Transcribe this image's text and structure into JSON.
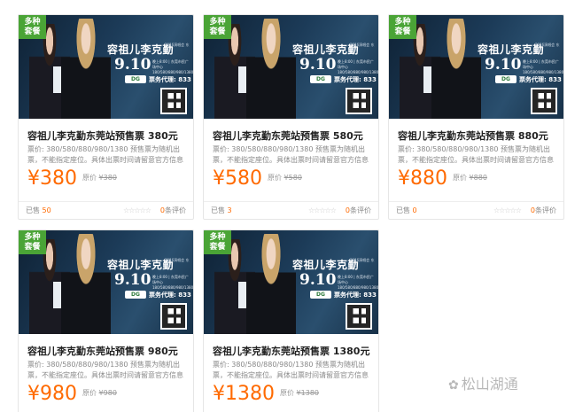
{
  "banner": {
    "tag": "多种\n套餐",
    "title": "容祖儿李克勤",
    "subtitle": "2016演唱会 东莞站",
    "date": "9.10",
    "venue": "晚上8:00 | 东莞市民广场中心 180/580/880/980/1380",
    "logo": "DG",
    "hotline": "票务代理: 833 12345"
  },
  "products": [
    {
      "name": "容祖儿李克勤东莞站预售票 380元",
      "desc": "票价: 380/580/880/980/1380 预售票为随机出票，不能指定座位。具体出票时间请留意官方信息(若：购买",
      "price": "¥380",
      "orig_label": "原价",
      "orig": "¥380",
      "sold_label": "已售",
      "sold": "50",
      "rating": "☆☆☆☆☆",
      "reviews": "0",
      "reviews_label": "条评价"
    },
    {
      "name": "容祖儿李克勤东莞站预售票 580元",
      "desc": "票价: 380/580/880/980/1380 预售票为随机出票，不能指定座位。具体出票时间请留意官方信息(若：购买",
      "price": "¥580",
      "orig_label": "原价",
      "orig": "¥580",
      "sold_label": "已售",
      "sold": "3",
      "rating": "☆☆☆☆☆",
      "reviews": "0",
      "reviews_label": "条评价"
    },
    {
      "name": "容祖儿李克勤东莞站预售票 880元",
      "desc": "票价: 380/580/880/980/1380 预售票为随机出票，不能指定座位。具体出票时间请留意官方信息(若：购买",
      "price": "¥880",
      "orig_label": "原价",
      "orig": "¥880",
      "sold_label": "已售",
      "sold": "0",
      "rating": "☆☆☆☆☆",
      "reviews": "0",
      "reviews_label": "条评价"
    },
    {
      "name": "容祖儿李克勤东莞站预售票 980元",
      "desc": "票价: 380/580/880/980/1380 预售票为随机出票，不能指定座位。具体出票时间请留意官方信息(若：购买",
      "price": "¥980",
      "orig_label": "原价",
      "orig": "¥980"
    },
    {
      "name": "容祖儿李克勤东莞站预售票 1380元",
      "desc": "票价: 380/580/880/980/1380 预售票为随机出票，不能指定座位。具体出票时间请留意官方信息(若：购买",
      "price": "¥1380",
      "orig_label": "原价",
      "orig": "¥1380"
    }
  ],
  "watermark": {
    "icon": "wechat-icon",
    "text": "松山湖通"
  }
}
